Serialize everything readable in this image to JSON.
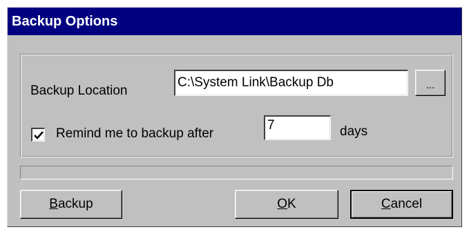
{
  "window": {
    "title": "Backup Options"
  },
  "location": {
    "label": "Backup Location",
    "value": "C:\\System Link\\Backup Db",
    "browse_label": "..."
  },
  "reminder": {
    "checked": true,
    "label": "Remind me to backup after",
    "days_value": "7",
    "days_unit": "days"
  },
  "buttons": {
    "backup_prefix": "",
    "backup_mnemonic": "B",
    "backup_rest": "ackup",
    "ok_prefix": "",
    "ok_mnemonic": "O",
    "ok_rest": "K",
    "cancel_prefix": "",
    "cancel_mnemonic": "C",
    "cancel_rest": "ancel"
  },
  "colors": {
    "titlebar": "#000080",
    "face": "#c0c0c0"
  },
  "icons": {
    "checkbox_mark": "checkmark-icon"
  }
}
